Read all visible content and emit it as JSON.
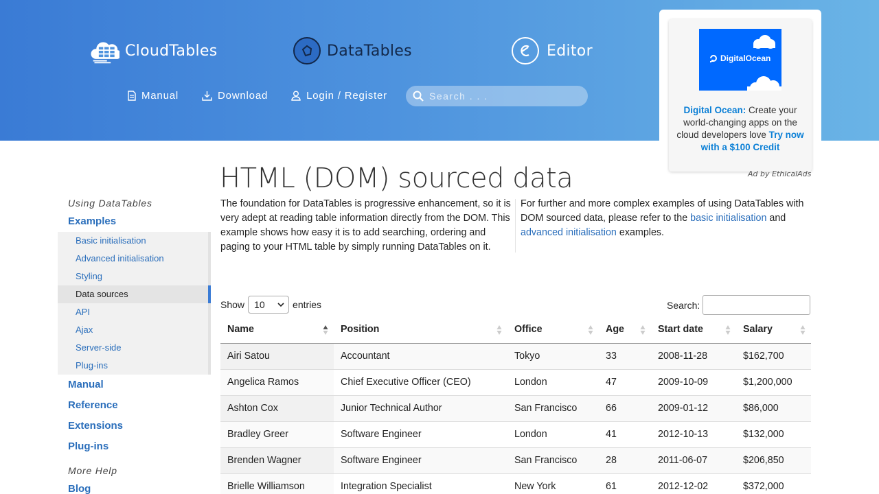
{
  "brands": {
    "cloudtables": "CloudTables",
    "datatables": "DataTables",
    "editor": "Editor"
  },
  "topnav": {
    "manual": "Manual",
    "download": "Download",
    "login": "Login / Register",
    "search_placeholder": "Search . . ."
  },
  "ad": {
    "brand_label": "DigitalOcean",
    "lead": "Digital Ocean:",
    "body": " Create your world-changing apps on the cloud developers love ",
    "cta": "Try now with a $100 Credit",
    "by": "Ad by EthicalAds"
  },
  "sidebar": {
    "heading": "Using DataTables",
    "examples": "Examples",
    "items": [
      "Basic initialisation",
      "Advanced initialisation",
      "Styling",
      "Data sources",
      "API",
      "Ajax",
      "Server-side",
      "Plug-ins"
    ],
    "manual": "Manual",
    "reference": "Reference",
    "extensions": "Extensions",
    "plugins": "Plug-ins",
    "more_help": "More Help",
    "blog": "Blog"
  },
  "main": {
    "title": "HTML (DOM) sourced data",
    "intro_left": "The foundation for DataTables is progressive enhancement, so it is very adept at reading table information directly from the DOM. This example shows how easy it is to add searching, ordering and paging to your HTML table by simply running DataTables on it.",
    "intro_right_1": "For further and more complex examples of using DataTables with DOM sourced data, please refer to the ",
    "intro_link_1": "basic initialisation",
    "intro_right_2": " and ",
    "intro_link_2": "advanced initialisation",
    "intro_right_3": " examples."
  },
  "table_controls": {
    "show": "Show",
    "length_value": "10",
    "entries": "entries",
    "search_label": "Search:"
  },
  "table": {
    "columns": [
      "Name",
      "Position",
      "Office",
      "Age",
      "Start date",
      "Salary"
    ],
    "rows": [
      [
        "Airi Satou",
        "Accountant",
        "Tokyo",
        "33",
        "2008-11-28",
        "$162,700"
      ],
      [
        "Angelica Ramos",
        "Chief Executive Officer (CEO)",
        "London",
        "47",
        "2009-10-09",
        "$1,200,000"
      ],
      [
        "Ashton Cox",
        "Junior Technical Author",
        "San Francisco",
        "66",
        "2009-01-12",
        "$86,000"
      ],
      [
        "Bradley Greer",
        "Software Engineer",
        "London",
        "41",
        "2012-10-13",
        "$132,000"
      ],
      [
        "Brenden Wagner",
        "Software Engineer",
        "San Francisco",
        "28",
        "2011-06-07",
        "$206,850"
      ],
      [
        "Brielle Williamson",
        "Integration Specialist",
        "New York",
        "61",
        "2012-12-02",
        "$372,000"
      ]
    ]
  },
  "colors": {
    "header_start": "#3a7bd5",
    "header_end": "#6ab4e6",
    "link": "#2a6ebb",
    "ad_bg": "#0069ff"
  }
}
